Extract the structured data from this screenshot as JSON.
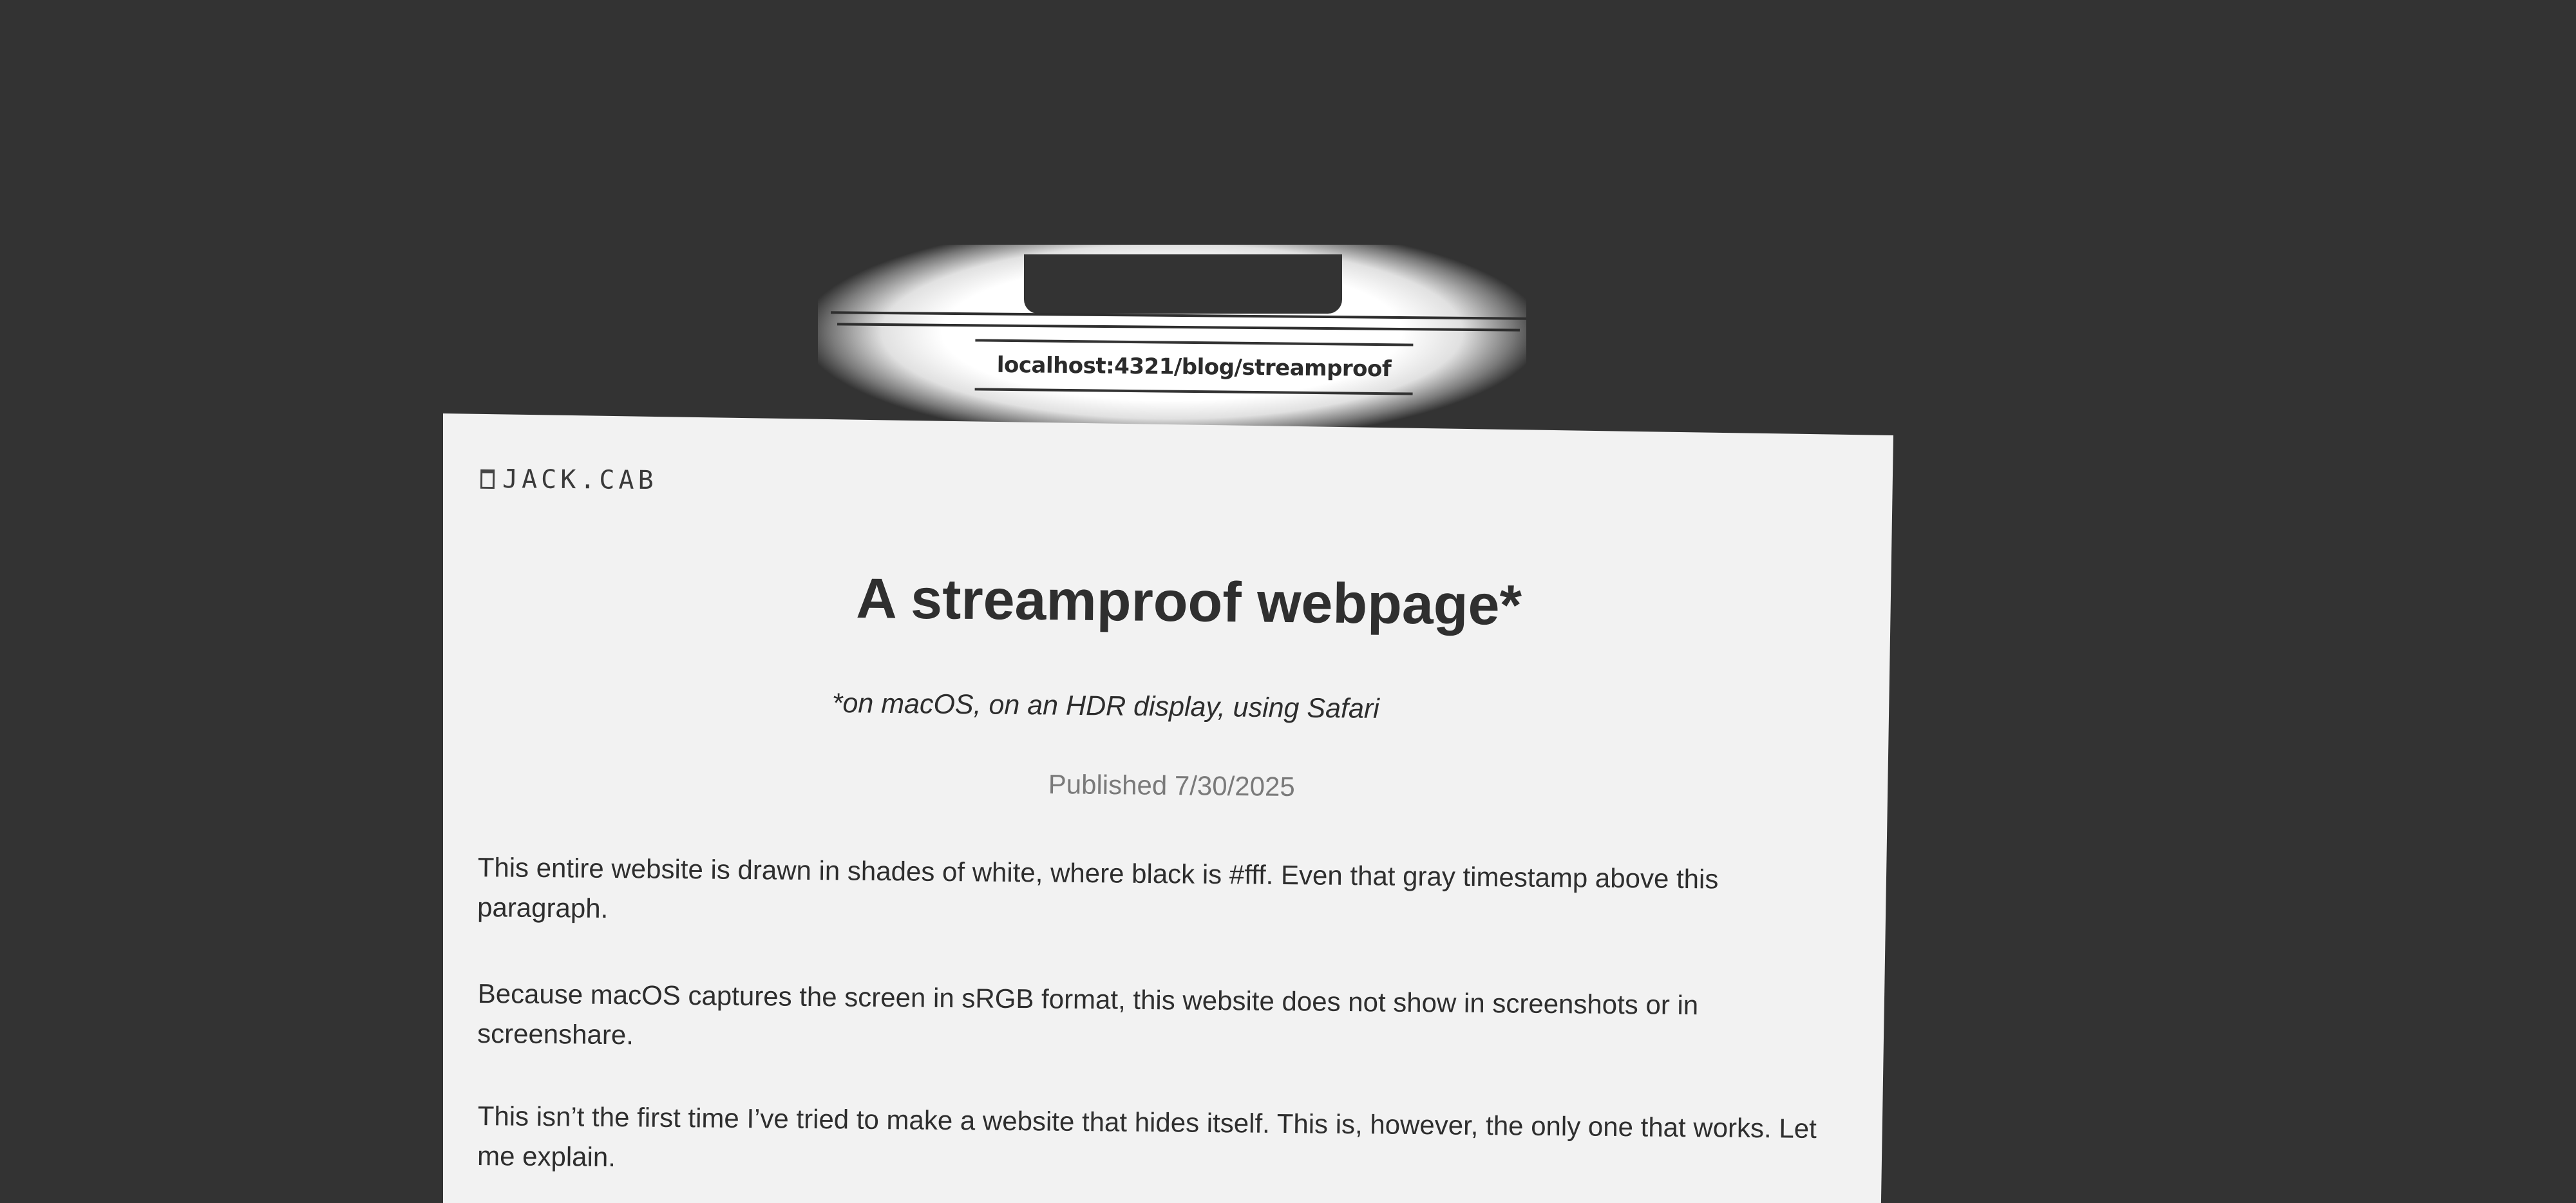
{
  "browser": {
    "url": "localhost:4321/blog/streamproof"
  },
  "site": {
    "brand": "JACK.CAB",
    "brand_icon": "page-icon"
  },
  "article": {
    "title": "A streamproof webpage*",
    "subtitle": "*on macOS, on an HDR display, using Safari",
    "published": "Published 7/30/2025",
    "paragraphs": [
      "This entire website is drawn in shades of white, where black is #fff. Even that gray timestamp above this paragraph.",
      "Because macOS captures the screen in sRGB format, this website does not show in screenshots or in screenshare.",
      "This isn’t the first time I’ve tried to make a website that hides itself. This is, however, the only one that works. Let me explain."
    ]
  },
  "colors": {
    "background": "#333333",
    "page": "#f2f2f2",
    "text": "#2e2e2e",
    "muted": "#7a7a7a"
  }
}
